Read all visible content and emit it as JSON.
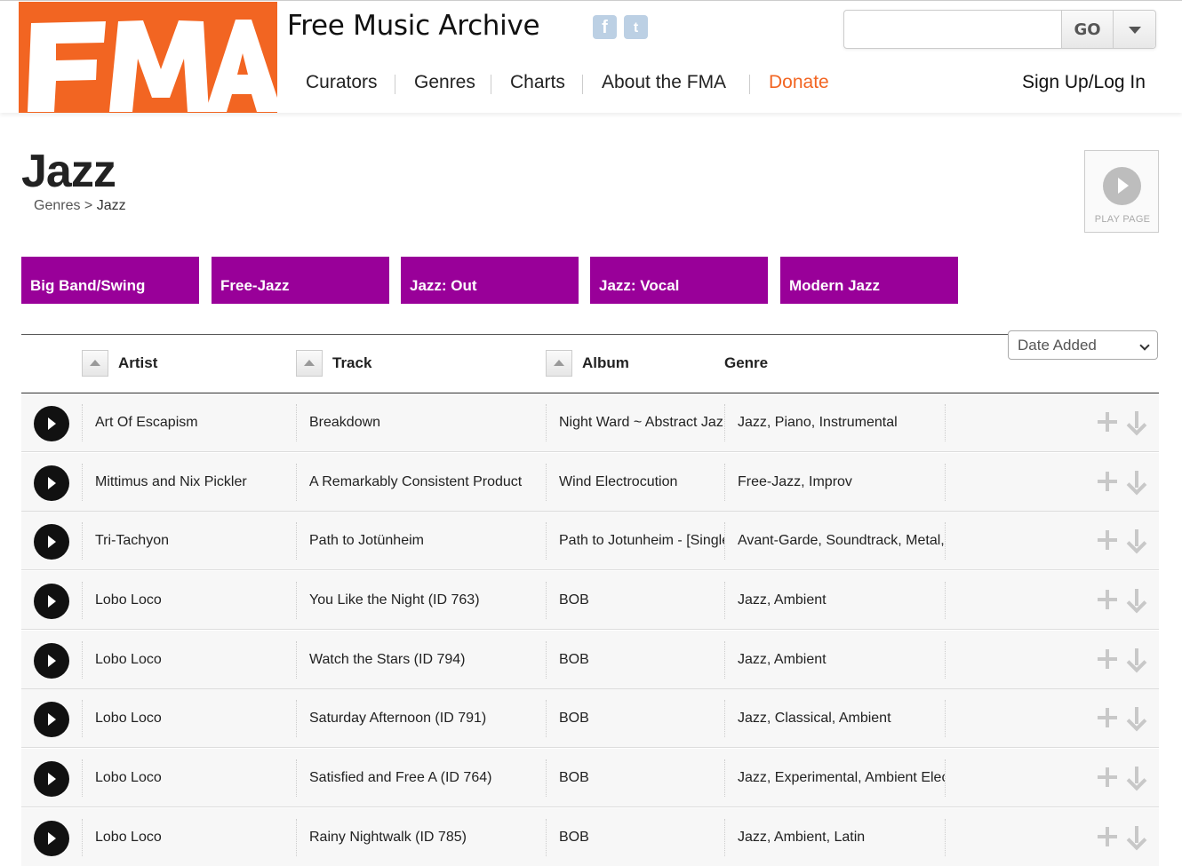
{
  "header": {
    "logo_text": "FMA",
    "site_title": "Free Music Archive",
    "social": [
      {
        "icon": "facebook-icon",
        "glyph": "f"
      },
      {
        "icon": "twitter-icon",
        "glyph": "t"
      }
    ],
    "search": {
      "value": "",
      "placeholder": "",
      "go_label": "GO"
    },
    "nav": [
      "Curators",
      "Genres",
      "Charts",
      "About the FMA",
      "Donate"
    ],
    "signup": "Sign Up/Log In",
    "colors": {
      "brand": "#f26522",
      "tile": "#990099"
    }
  },
  "page": {
    "title": "Jazz",
    "breadcrumb": {
      "parent": "Genres",
      "sep": ">",
      "current": "Jazz"
    },
    "play_page_label": "PLAY PAGE"
  },
  "subgenres": [
    "Big Band/Swing",
    "Free-Jazz",
    "Jazz: Out",
    "Jazz: Vocal",
    "Modern Jazz"
  ],
  "table": {
    "columns": [
      "Artist",
      "Track",
      "Album",
      "Genre"
    ],
    "sort_selected": "Date Added",
    "rows": [
      {
        "artist": "Art Of Escapism",
        "track": "Breakdown",
        "album": "Night Ward ~ Abstract Jaz",
        "genre": "Jazz, Piano, Instrumental"
      },
      {
        "artist": "Mittimus and Nix Pickler",
        "track": "A Remarkably Consistent Product",
        "album": "Wind Electrocution",
        "genre": "Free-Jazz, Improv"
      },
      {
        "artist": "Tri-Tachyon",
        "track": "Path to Jotünheim",
        "album": "Path to Jotunheim - [Single",
        "genre": "Avant-Garde, Soundtrack, Metal,"
      },
      {
        "artist": "Lobo Loco",
        "track": "You Like the Night (ID 763)",
        "album": "BOB",
        "genre": "Jazz, Ambient"
      },
      {
        "artist": "Lobo Loco",
        "track": "Watch the Stars (ID 794)",
        "album": "BOB",
        "genre": "Jazz, Ambient"
      },
      {
        "artist": "Lobo Loco",
        "track": "Saturday Afternoon (ID 791)",
        "album": "BOB",
        "genre": "Jazz, Classical, Ambient"
      },
      {
        "artist": "Lobo Loco",
        "track": "Satisfied and Free A (ID 764)",
        "album": "BOB",
        "genre": "Jazz, Experimental, Ambient Elect"
      },
      {
        "artist": "Lobo Loco",
        "track": "Rainy Nightwalk (ID 785)",
        "album": "BOB",
        "genre": "Jazz, Ambient, Latin"
      }
    ]
  }
}
